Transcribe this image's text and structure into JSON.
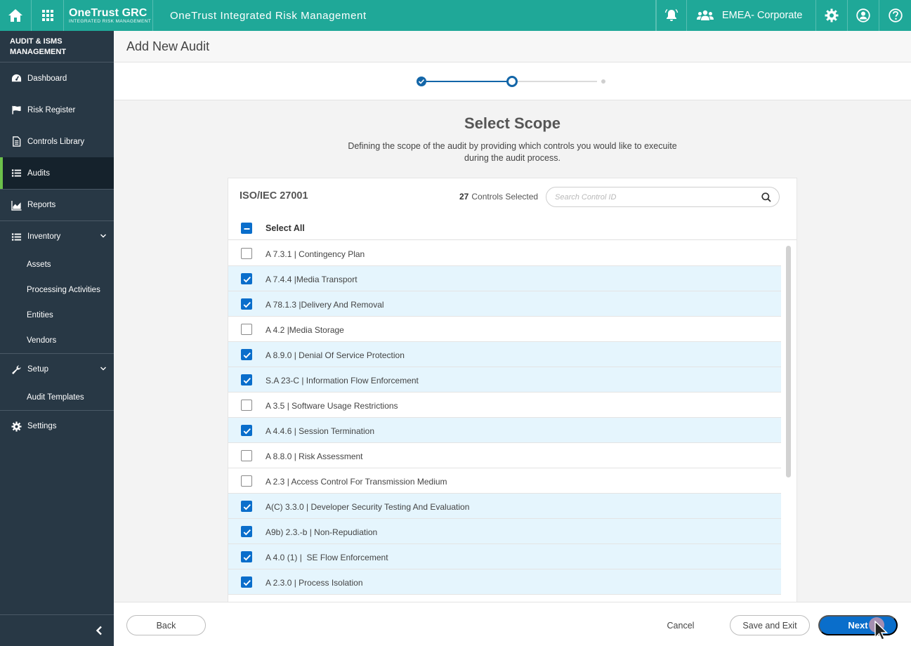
{
  "topbar": {
    "brand_name": "OneTrust GRC",
    "brand_sub": "INTEGRATED RISK MANAGEMENT",
    "app_title": "OneTrust Integrated Risk Management",
    "org_name": "EMEA- Corporate",
    "icons": [
      "home-icon",
      "app-grid-icon",
      "bell-icon",
      "users-icon",
      "gear-icon",
      "user-circle-icon",
      "help-icon"
    ],
    "color": "#1fa898"
  },
  "sidebar": {
    "section_title": "AUDIT & ISMS MANAGEMENT",
    "items": [
      {
        "label": "Dashboard",
        "icon": "dashboard-icon"
      },
      {
        "label": "Risk Register",
        "icon": "flag-icon"
      },
      {
        "label": "Controls Library",
        "icon": "document-icon"
      },
      {
        "label": "Audits",
        "icon": "list-icon",
        "active": true
      },
      {
        "label": "Reports",
        "icon": "area-chart-icon"
      },
      {
        "label": "Inventory",
        "icon": "list-icon"
      },
      {
        "label": "Setup",
        "icon": "wrench-icon"
      },
      {
        "label": "Settings",
        "icon": "gear-icon"
      }
    ],
    "inventory_sub": [
      "Assets",
      "Processing Activities",
      "Entities",
      "Vendors"
    ],
    "setup_sub": [
      "Audit Templates"
    ],
    "active_color": "#6cc04a"
  },
  "page": {
    "title": "Add New Audit"
  },
  "stepper": {
    "current_step": 2,
    "total_steps": 3
  },
  "scope": {
    "title": "Select Scope",
    "description": "Defining the scope of the audit by providing which controls you would like to execuite during the audit process."
  },
  "card": {
    "standard": "ISO/IEC 27001",
    "selected_count": "27",
    "selected_label": "Controls Selected",
    "search_placeholder": "Search Control ID",
    "select_all_label": "Select All",
    "controls": [
      {
        "label": "A 7.3.1 | Contingency Plan",
        "checked": false
      },
      {
        "label": "A 7.4.4 |Media Transport",
        "checked": true
      },
      {
        "label": "A 78.1.3 |Delivery And Removal",
        "checked": true
      },
      {
        "label": "A 4.2 |Media Storage",
        "checked": false
      },
      {
        "label": "A 8.9.0 | Denial Of Service Protection",
        "checked": true
      },
      {
        "label": "S.A 23-C | Information Flow Enforcement",
        "checked": true
      },
      {
        "label": "A 3.5 | Software Usage Restrictions",
        "checked": false
      },
      {
        "label": "A 4.4.6 | Session Termination",
        "checked": true
      },
      {
        "label": "A 8.8.0 | Risk Assessment",
        "checked": false
      },
      {
        "label": "A 2.3 | Access Control For Transmission Medium",
        "checked": false
      },
      {
        "label": "A(C) 3.3.0 | Developer Security Testing And Evaluation",
        "checked": true
      },
      {
        "label": "A9b) 2.3.-b | Non-Repudiation",
        "checked": true
      },
      {
        "label": "A 4.0 (1) |  SE Flow Enforcement",
        "checked": true
      },
      {
        "label": "A 2.3.0 | Process Isolation",
        "checked": true
      }
    ]
  },
  "footer": {
    "back_label": "Back",
    "cancel_label": "Cancel",
    "save_exit_label": "Save and Exit",
    "next_label": "Next",
    "primary_color": "#0a6ecb"
  }
}
